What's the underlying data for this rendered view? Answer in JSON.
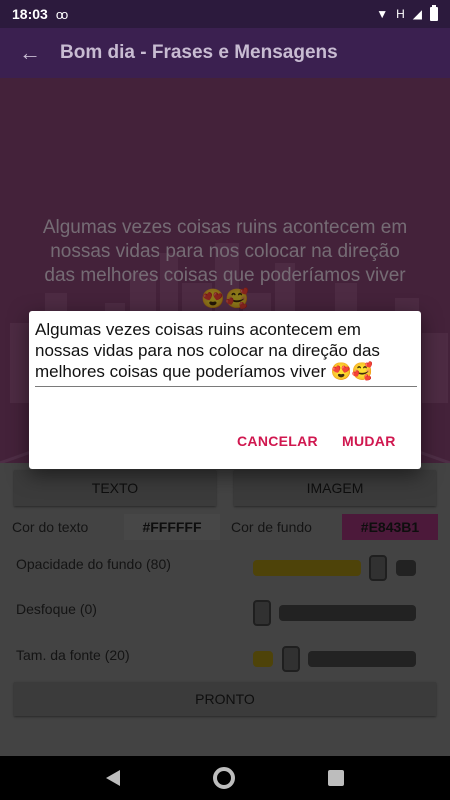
{
  "status": {
    "time": "18:03",
    "voicemail": "oo",
    "network": "H"
  },
  "app_bar": {
    "title": "Bom dia - Frases e Mensagens"
  },
  "preview": {
    "text": "Algumas vezes coisas ruins acontecem em nossas vidas para nos colocar na direção das melhores coisas que poderíamos viver 😍🥰"
  },
  "dialog": {
    "input_value": "Algumas vezes coisas ruins acontecem em nossas vidas para nos colocar na direção das melhores coisas que poderíamos viver 😍🥰",
    "cancel_label": "CANCELAR",
    "change_label": "MUDAR"
  },
  "tabs": {
    "text_label": "TEXTO",
    "image_label": "IMAGEM"
  },
  "colors": {
    "text_label": "Cor do texto",
    "text_value": "#FFFFFF",
    "bg_label": "Cor de fundo",
    "bg_value": "#E843B1"
  },
  "sliders": {
    "opacity_label": "Opacidade do fundo (80)",
    "opacity_value": 80,
    "blur_label": "Desfoque (0)",
    "blur_value": 0,
    "font_label": "Tam. da fonte (20)",
    "font_value": 20
  },
  "done_label": "PRONTO"
}
